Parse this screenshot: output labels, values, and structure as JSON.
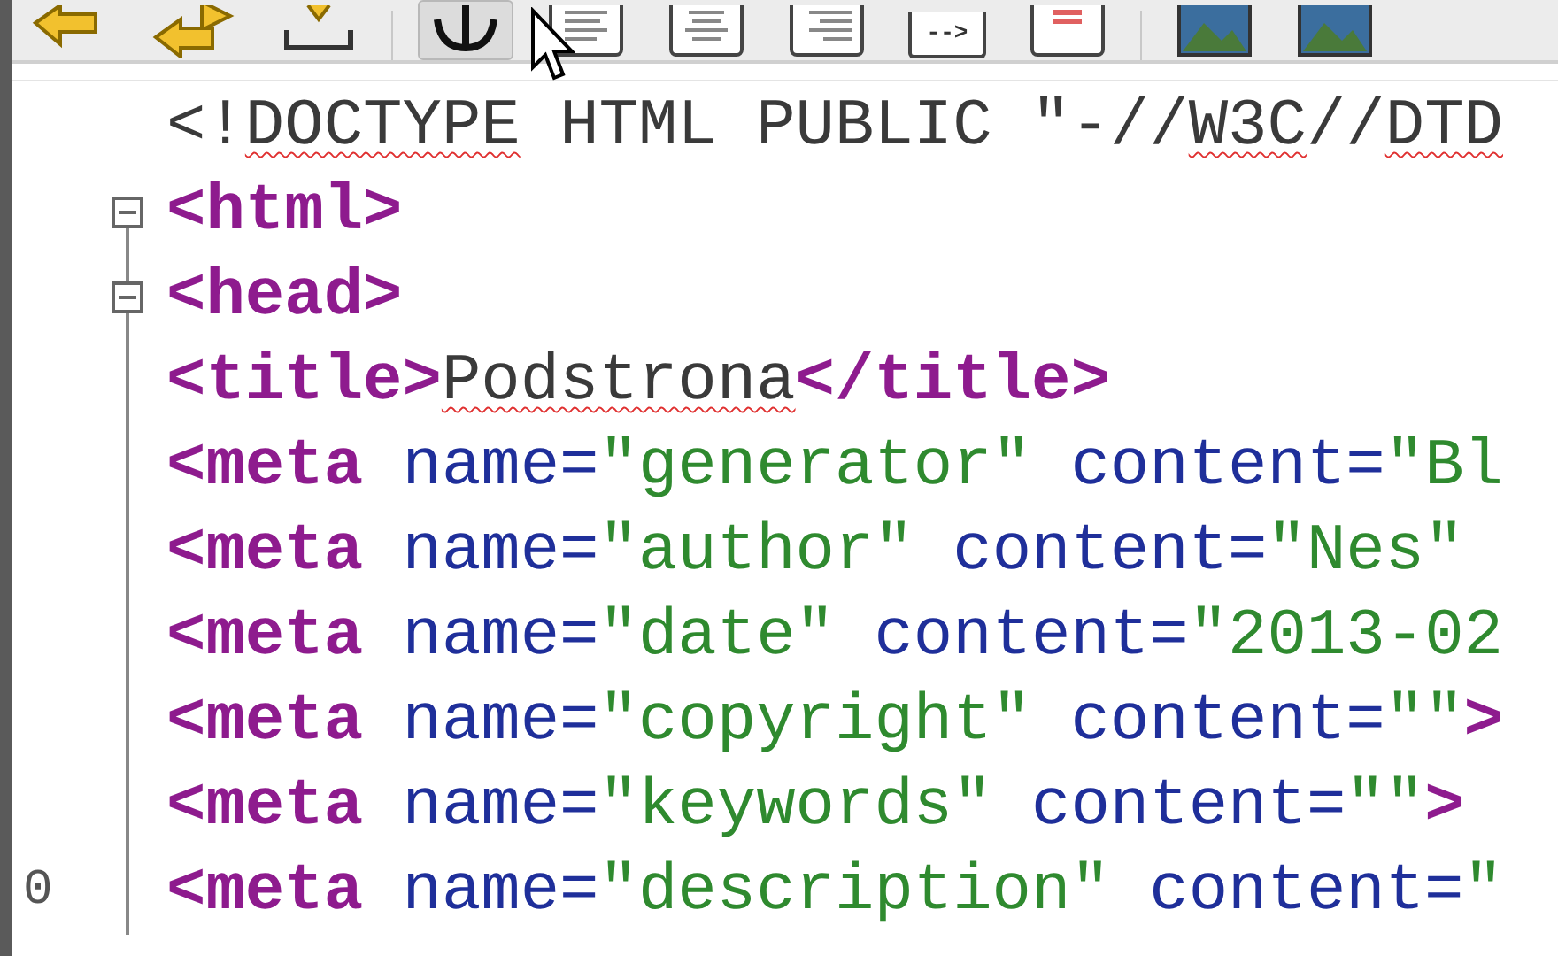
{
  "toolbar": {
    "buttons": [
      {
        "kind": "arrow-left",
        "selected": false
      },
      {
        "kind": "arrows-swap",
        "selected": false
      },
      {
        "kind": "tray",
        "selected": false
      },
      {
        "kind": "anchor",
        "selected": true
      },
      {
        "kind": "doc-left",
        "selected": false
      },
      {
        "kind": "doc-center",
        "selected": false
      },
      {
        "kind": "doc-right",
        "selected": false
      },
      {
        "kind": "doc-label",
        "selected": false,
        "label": "-->"
      },
      {
        "kind": "doc-red",
        "selected": false
      },
      {
        "kind": "picture",
        "selected": false
      },
      {
        "kind": "picture",
        "selected": false
      }
    ]
  },
  "editor": {
    "lines": [
      {
        "fold": false,
        "tokens": [
          {
            "kind": "plain",
            "text": "<!"
          },
          {
            "kind": "plain",
            "text": "DOCTYPE",
            "misspelled": true
          },
          {
            "kind": "plain",
            "text": " HTML PUBLIC \"-//"
          },
          {
            "kind": "plain",
            "text": "W3C",
            "misspelled": true
          },
          {
            "kind": "plain",
            "text": "//"
          },
          {
            "kind": "plain",
            "text": "DTD",
            "misspelled": true
          }
        ]
      },
      {
        "fold": true,
        "tokens": [
          {
            "kind": "tag",
            "text": "<html>"
          }
        ]
      },
      {
        "fold": true,
        "tokens": [
          {
            "kind": "tag",
            "text": "<head>"
          }
        ]
      },
      {
        "fold": false,
        "tokens": [
          {
            "kind": "tag",
            "text": "<title>"
          },
          {
            "kind": "plain",
            "text": "Podstrona",
            "misspelled": true
          },
          {
            "kind": "tag",
            "text": "</title>"
          }
        ]
      },
      {
        "fold": false,
        "tokens": [
          {
            "kind": "tag",
            "text": "<meta"
          },
          {
            "kind": "attr",
            "text": " name="
          },
          {
            "kind": "value",
            "text": "\"generator\""
          },
          {
            "kind": "attr",
            "text": " content="
          },
          {
            "kind": "value",
            "text": "\"Bl"
          }
        ]
      },
      {
        "fold": false,
        "tokens": [
          {
            "kind": "tag",
            "text": "<meta"
          },
          {
            "kind": "attr",
            "text": " name="
          },
          {
            "kind": "value",
            "text": "\"author\""
          },
          {
            "kind": "attr",
            "text": " content="
          },
          {
            "kind": "value",
            "text": "\"Nes\""
          }
        ]
      },
      {
        "fold": false,
        "tokens": [
          {
            "kind": "tag",
            "text": "<meta"
          },
          {
            "kind": "attr",
            "text": " name="
          },
          {
            "kind": "value",
            "text": "\"date\""
          },
          {
            "kind": "attr",
            "text": " content="
          },
          {
            "kind": "value",
            "text": "\"2013-02"
          }
        ]
      },
      {
        "fold": false,
        "tokens": [
          {
            "kind": "tag",
            "text": "<meta"
          },
          {
            "kind": "attr",
            "text": " name="
          },
          {
            "kind": "value",
            "text": "\"copyright\""
          },
          {
            "kind": "attr",
            "text": " content="
          },
          {
            "kind": "value",
            "text": "\"\""
          },
          {
            "kind": "tag",
            "text": ">"
          }
        ]
      },
      {
        "fold": false,
        "tokens": [
          {
            "kind": "tag",
            "text": "<meta"
          },
          {
            "kind": "attr",
            "text": " name="
          },
          {
            "kind": "value",
            "text": "\"keywords\""
          },
          {
            "kind": "attr",
            "text": " content="
          },
          {
            "kind": "value",
            "text": "\"\""
          },
          {
            "kind": "tag",
            "text": ">"
          }
        ]
      },
      {
        "number": "0",
        "fold": false,
        "tokens": [
          {
            "kind": "tag",
            "text": "<meta"
          },
          {
            "kind": "attr",
            "text": " name="
          },
          {
            "kind": "value",
            "text": "\"description\""
          },
          {
            "kind": "attr",
            "text": " content="
          },
          {
            "kind": "value",
            "text": "\""
          }
        ]
      }
    ]
  }
}
